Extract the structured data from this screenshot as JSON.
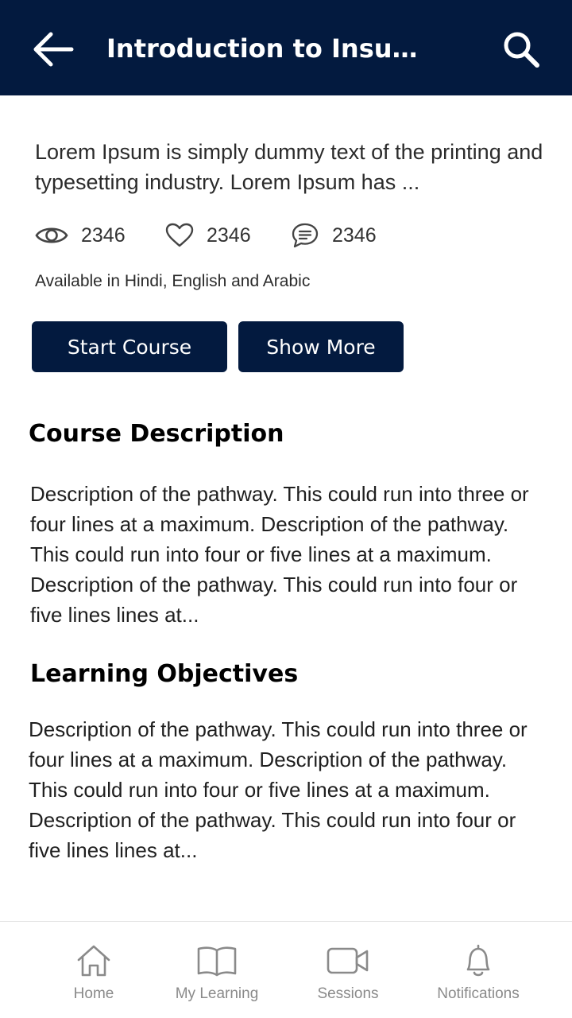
{
  "header": {
    "title": "Introduction to Insur...",
    "back_icon": "arrow-left-icon",
    "search_icon": "search-icon",
    "background": "#031a3f"
  },
  "course": {
    "summary": "Lorem Ipsum is simply dummy text of the printing and typesetting industry. Lorem Ipsum has ...",
    "stats": {
      "views": "2346",
      "likes": "2346",
      "comments": "2346"
    },
    "languages": "Available in Hindi, English and Arabic"
  },
  "actions": {
    "start_label": "Start Course",
    "more_label": "Show More"
  },
  "sections": {
    "description": {
      "title": "Course Description",
      "body": "Description of the pathway. This could run into three or four lines at a maximum. Description of the pathway. This could run into four or five lines at a maximum. Description of the pathway. This could run into four or five lines lines at..."
    },
    "objectives": {
      "title": "Learning Objectives",
      "body": "Description of the pathway. This could run into three or four lines at a maximum. Description of the pathway. This could run into four or five lines at a maximum. Description of the pathway. This could run into four or five lines lines at..."
    }
  },
  "bottom_nav": {
    "items": [
      {
        "label": "Home",
        "icon": "home-icon"
      },
      {
        "label": "My Learning",
        "icon": "book-icon"
      },
      {
        "label": "Sessions",
        "icon": "video-camera-icon"
      },
      {
        "label": "Notifications",
        "icon": "bell-icon"
      }
    ]
  }
}
